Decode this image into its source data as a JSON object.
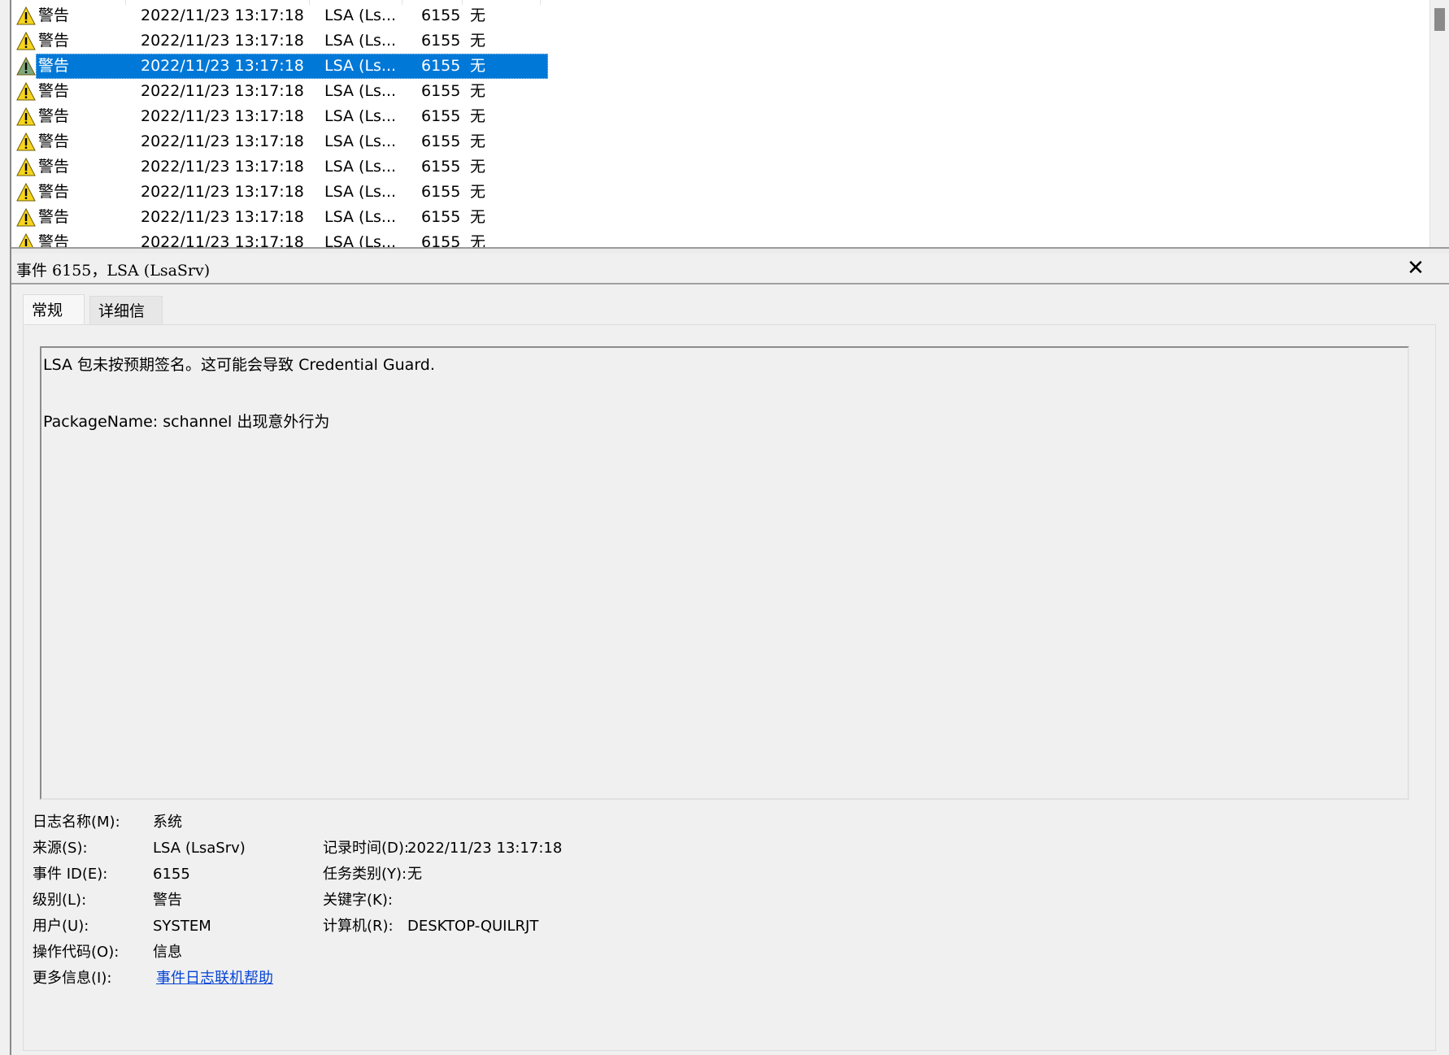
{
  "event_list": {
    "rows": [
      {
        "level": "警告",
        "date": "2022/11/23 13:17:18",
        "source": "LSA (Ls...",
        "event_id": "6155",
        "task": "无",
        "selected": false
      },
      {
        "level": "警告",
        "date": "2022/11/23 13:17:18",
        "source": "LSA (Ls...",
        "event_id": "6155",
        "task": "无",
        "selected": false
      },
      {
        "level": "警告",
        "date": "2022/11/23 13:17:18",
        "source": "LSA (Ls...",
        "event_id": "6155",
        "task": "无",
        "selected": true
      },
      {
        "level": "警告",
        "date": "2022/11/23 13:17:18",
        "source": "LSA (Ls...",
        "event_id": "6155",
        "task": "无",
        "selected": false
      },
      {
        "level": "警告",
        "date": "2022/11/23 13:17:18",
        "source": "LSA (Ls...",
        "event_id": "6155",
        "task": "无",
        "selected": false
      },
      {
        "level": "警告",
        "date": "2022/11/23 13:17:18",
        "source": "LSA (Ls...",
        "event_id": "6155",
        "task": "无",
        "selected": false
      },
      {
        "level": "警告",
        "date": "2022/11/23 13:17:18",
        "source": "LSA (Ls...",
        "event_id": "6155",
        "task": "无",
        "selected": false
      },
      {
        "level": "警告",
        "date": "2022/11/23 13:17:18",
        "source": "LSA (Ls...",
        "event_id": "6155",
        "task": "无",
        "selected": false
      },
      {
        "level": "警告",
        "date": "2022/11/23 13:17:18",
        "source": "LSA (Ls...",
        "event_id": "6155",
        "task": "无",
        "selected": false
      },
      {
        "level": "警告",
        "date": "2022/11/23 13:17:18",
        "source": "LSA (Ls...",
        "event_id": "6155",
        "task": "无",
        "selected": false
      }
    ],
    "row_icon": "warning-icon"
  },
  "detail": {
    "title": "事件 6155，LSA (LsaSrv)",
    "close_icon": "close-icon",
    "tabs": [
      {
        "label": "常规",
        "active": true
      },
      {
        "label": "详细信息",
        "active": false
      }
    ],
    "message": {
      "line1": "LSA 包未按预期签名。这可能会导致 Credential Guard.",
      "line2": "PackageName:  schannel  出现意外行为"
    },
    "properties": {
      "log_name_label": "日志名称(M):",
      "log_name_value": "系统",
      "source_label": "来源(S):",
      "source_value": "LSA (LsaSrv)",
      "logged_label": "记录时间(D):",
      "logged_value": "2022/11/23 13:17:18",
      "event_id_label": "事件 ID(E):",
      "event_id_value": "6155",
      "task_label": "任务类别(Y):",
      "task_value": "无",
      "level_label": "级别(L):",
      "level_value": "警告",
      "keywords_label": "关键字(K):",
      "keywords_value": "",
      "user_label": "用户(U):",
      "user_value": "SYSTEM",
      "computer_label": "计算机(R):",
      "computer_value": "DESKTOP-QUILRJT",
      "opcode_label": "操作代码(O):",
      "opcode_value": "信息",
      "more_info_label": "更多信息(I):",
      "more_info_link": "事件日志联机帮助"
    }
  },
  "colors": {
    "selection": "#0078d7",
    "warning_fill": "#f7d51d",
    "link": "#0645d6"
  }
}
